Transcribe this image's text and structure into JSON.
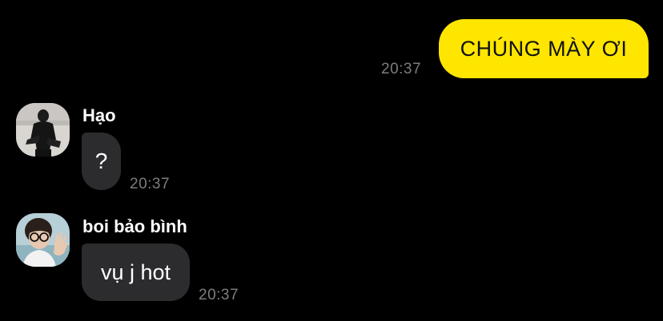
{
  "messages": [
    {
      "direction": "outgoing",
      "text": "CHÚNG MÀY ƠI",
      "time": "20:37",
      "bubble_color": "#ffe600"
    },
    {
      "direction": "incoming",
      "sender": "Hạo",
      "avatar": "avatar-photo-man-in-black",
      "text": "?",
      "time": "20:37",
      "bubble_color": "#2c2c2e"
    },
    {
      "direction": "incoming",
      "sender": "boi bảo bình",
      "avatar": "avatar-photo-man-with-glasses-waving",
      "text": "vụ j hot",
      "time": "20:37",
      "bubble_color": "#2c2c2e"
    }
  ],
  "theme": {
    "background": "#000000",
    "timestamp_color": "#7d7d7d"
  }
}
